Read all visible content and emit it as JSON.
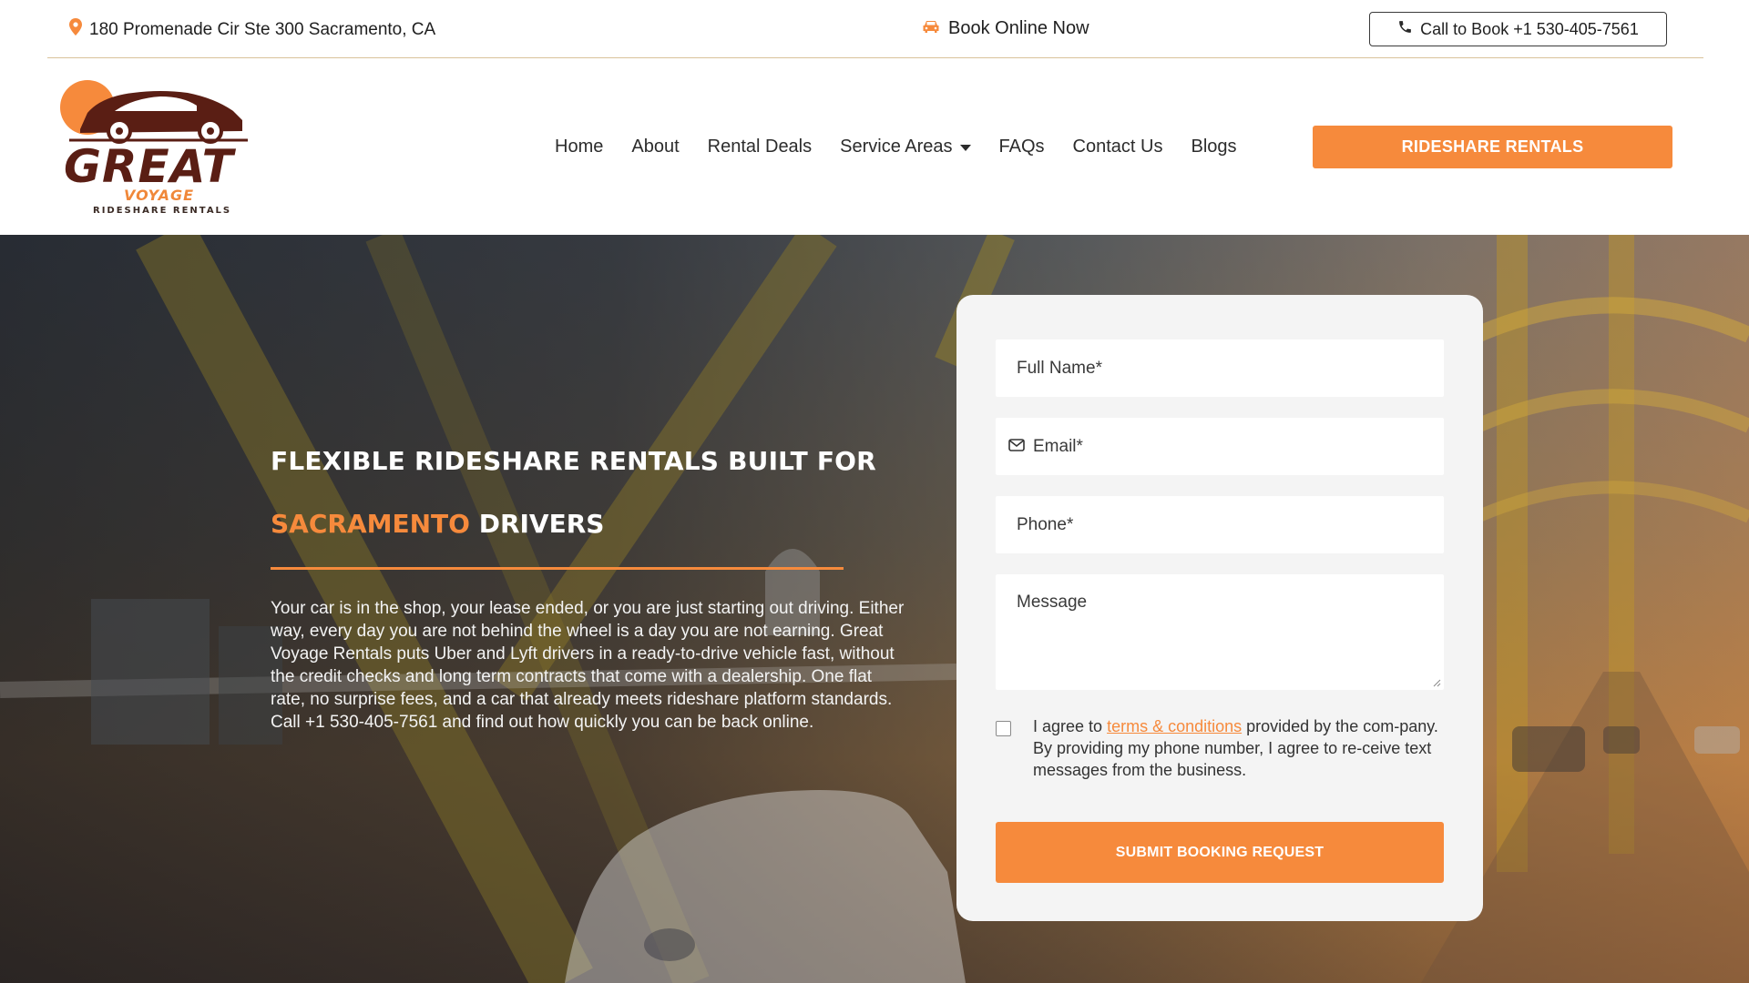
{
  "topbar": {
    "address": "180 Promenade Cir Ste 300 Sacramento, CA",
    "address_icon": "map-pin-icon",
    "book_online": "Book Online Now",
    "book_icon": "car-icon",
    "call_label": "Call to Book +1 530-405-7561",
    "call_icon": "phone-icon"
  },
  "logo": {
    "wordmark": "GREAT",
    "subword": "VOYAGE",
    "tagline": "RIDESHARE RENTALS"
  },
  "nav": {
    "items": [
      {
        "label": "Home"
      },
      {
        "label": "About"
      },
      {
        "label": "Rental Deals"
      },
      {
        "label": "Service Areas",
        "has_dropdown": true
      },
      {
        "label": "FAQs"
      },
      {
        "label": "Contact Us"
      },
      {
        "label": "Blogs"
      }
    ],
    "cta_label": "RIDESHARE RENTALS"
  },
  "hero": {
    "title_line1": "FLEXIBLE RIDESHARE RENTALS BUILT FOR",
    "title_highlight": "SACRAMENTO",
    "title_rest": "DRIVERS",
    "body": "Your car is in the shop, your lease ended, or you are just starting out driving. Either way, every day you are not behind the wheel is a day you are not earning. Great Voyage Rentals puts Uber and Lyft drivers in a ready-to-drive vehicle fast, without the credit checks and long term contracts that come with a dealership. One flat rate, no surprise fees, and a car that already meets rideshare platform standards. Call +1 530-405-7561 and find out how quickly you can be back online."
  },
  "form": {
    "full_name_placeholder": "Full Name*",
    "email_placeholder": "Email*",
    "email_icon": "envelope-icon",
    "phone_placeholder": "Phone*",
    "message_placeholder": "Message",
    "consent_prefix": "I agree to ",
    "consent_link": "terms & conditions",
    "consent_suffix": " provided by the com-pany. By providing my phone number, I agree to re-ceive text messages from the business.",
    "submit_label": "SUBMIT BOOKING REQUEST"
  },
  "colors": {
    "accent": "#f68a3c",
    "logo_brown": "#5a1e14",
    "text_dark": "#2c2c2c"
  }
}
